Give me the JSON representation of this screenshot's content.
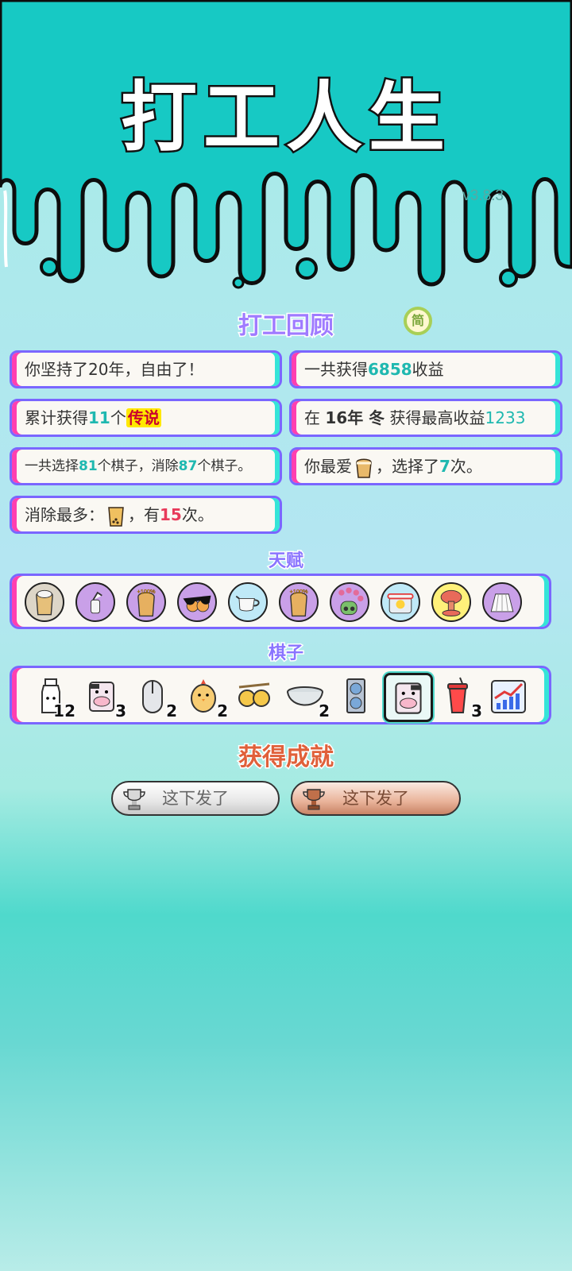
{
  "title": "打工人生",
  "version": "v3.8.3",
  "review": {
    "heading": "打工回顾",
    "badge": "简",
    "cards": {
      "c1": {
        "prefix": "你坚持了20年，自由了！"
      },
      "c2": {
        "prefix": "一共获得",
        "value": "6858",
        "suffix": "收益"
      },
      "c3": {
        "prefix": "累计获得",
        "value": "11",
        "mid": "个",
        "rarity": "传说"
      },
      "c4": {
        "p1": "在 ",
        "year": "16年 冬",
        "p2": " 获得最高收益",
        "value": "1233"
      },
      "c5": {
        "p1": "一共选择",
        "v1": "81",
        "p2": "个棋子，消除",
        "v2": "87",
        "p3": "个棋子。"
      },
      "c6": {
        "p1": "你最爱",
        "p2": "，选择了",
        "value": "7",
        "p3": "次。"
      },
      "c7": {
        "p1": "消除最多：",
        "p2": "，有",
        "value": "15",
        "p3": "次。"
      }
    }
  },
  "talents": {
    "heading": "天赋",
    "items": [
      "milk-tea-cup-icon",
      "breast-pump-icon",
      "milk-tea-plus100-icon",
      "sunglasses-oranges-icon",
      "milk-jug-icon",
      "milk-tea-plus100-icon",
      "flower-hat-person-icon",
      "duck-pot-icon",
      "mushroom-cloud-icon",
      "pleated-skirt-icon"
    ],
    "plus_label": "+100%"
  },
  "pieces": {
    "heading": "棋子",
    "items": [
      {
        "icon": "milk-bottle-icon",
        "count": "12"
      },
      {
        "icon": "cow-icon",
        "count": "3"
      },
      {
        "icon": "computer-mouse-icon",
        "count": "2"
      },
      {
        "icon": "chick-icon",
        "count": "2"
      },
      {
        "icon": "twin-oranges-icon",
        "count": ""
      },
      {
        "icon": "bowl-icon",
        "count": "2"
      },
      {
        "icon": "graphics-card-icon",
        "count": ""
      },
      {
        "icon": "cow-icon",
        "count": "",
        "selected": true
      },
      {
        "icon": "soda-cup-icon",
        "count": "3"
      },
      {
        "icon": "stock-chart-icon",
        "count": ""
      }
    ]
  },
  "achievements": {
    "heading": "获得成就",
    "items": [
      {
        "label": "这下发了",
        "tier": "silver"
      },
      {
        "label": "这下发了",
        "tier": "bronze"
      }
    ]
  },
  "colors": {
    "accent": "#7a66ff",
    "pink": "#ff3fb0",
    "teal": "#1fb8b0",
    "red": "#e83a5a"
  }
}
